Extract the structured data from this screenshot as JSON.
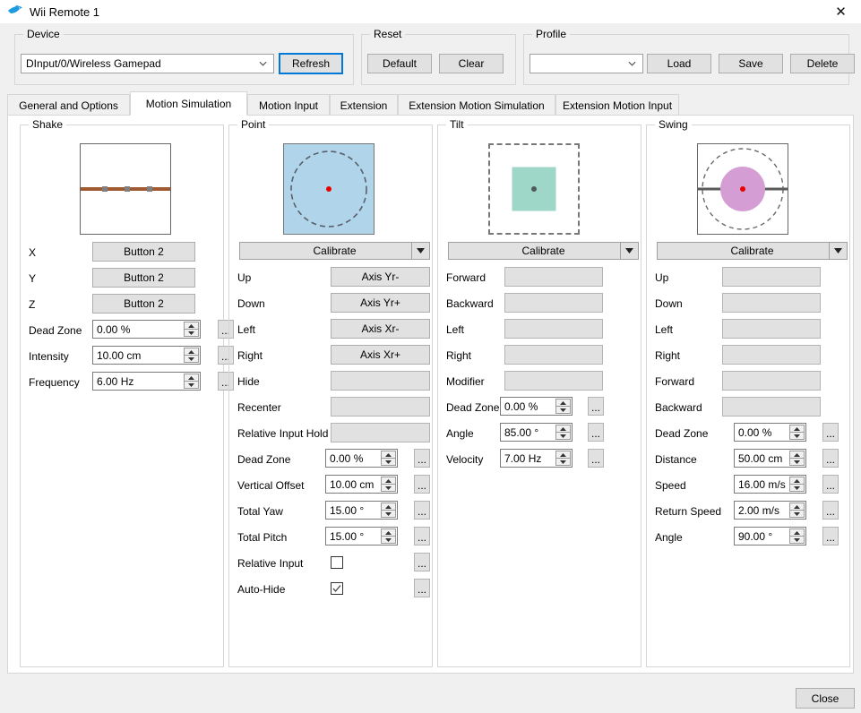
{
  "window": {
    "title": "Wii Remote 1",
    "icon": "dolphin-icon",
    "close_glyph": "✕"
  },
  "device": {
    "legend": "Device",
    "selected": "DInput/0/Wireless Gamepad",
    "refresh_label": "Refresh"
  },
  "reset": {
    "legend": "Reset",
    "default_label": "Default",
    "clear_label": "Clear"
  },
  "profile": {
    "legend": "Profile",
    "selected": "",
    "load_label": "Load",
    "save_label": "Save",
    "delete_label": "Delete"
  },
  "tabs": [
    {
      "label": "General and Options",
      "selected": false
    },
    {
      "label": "Motion Simulation",
      "selected": true
    },
    {
      "label": "Motion Input",
      "selected": false
    },
    {
      "label": "Extension",
      "selected": false
    },
    {
      "label": "Extension Motion Simulation",
      "selected": false
    },
    {
      "label": "Extension Motion Input",
      "selected": false
    }
  ],
  "shake": {
    "legend": "Shake",
    "rows": [
      {
        "label": "X",
        "value": "Button 2"
      },
      {
        "label": "Y",
        "value": "Button 2"
      },
      {
        "label": "Z",
        "value": "Button 2"
      }
    ],
    "spins": [
      {
        "label": "Dead Zone",
        "value": "0.00 %"
      },
      {
        "label": "Intensity",
        "value": "10.00 cm"
      },
      {
        "label": "Frequency",
        "value": "6.00 Hz"
      }
    ],
    "dots_label": "...",
    "preview": {
      "line_color": "#a05a32",
      "background": "#ffffff",
      "marker_color": "#808080"
    }
  },
  "point": {
    "legend": "Point",
    "calibrate_label": "Calibrate",
    "bindings": [
      {
        "label": "Up",
        "value": "Axis Yr-"
      },
      {
        "label": "Down",
        "value": "Axis Yr+"
      },
      {
        "label": "Left",
        "value": "Axis Xr-"
      },
      {
        "label": "Right",
        "value": "Axis Xr+"
      },
      {
        "label": "Hide",
        "value": ""
      },
      {
        "label": "Recenter",
        "value": ""
      },
      {
        "label": "Relative Input Hold",
        "value": ""
      }
    ],
    "spins": [
      {
        "label": "Dead Zone",
        "value": "0.00 %"
      },
      {
        "label": "Vertical Offset",
        "value": "10.00 cm"
      },
      {
        "label": "Total Yaw",
        "value": "15.00 °"
      },
      {
        "label": "Total Pitch",
        "value": "15.00 °"
      }
    ],
    "checks": [
      {
        "label": "Relative Input",
        "checked": false
      },
      {
        "label": "Auto-Hide",
        "checked": true
      }
    ],
    "dots_label": "...",
    "preview": {
      "fill": "#b0d4ea",
      "dot_color": "#e60000"
    }
  },
  "tilt": {
    "legend": "Tilt",
    "calibrate_label": "Calibrate",
    "bindings": [
      {
        "label": "Forward",
        "value": ""
      },
      {
        "label": "Backward",
        "value": ""
      },
      {
        "label": "Left",
        "value": ""
      },
      {
        "label": "Right",
        "value": ""
      },
      {
        "label": "Modifier",
        "value": ""
      }
    ],
    "spins": [
      {
        "label": "Dead Zone",
        "value": "0.00 %"
      },
      {
        "label": "Angle",
        "value": "85.00 °"
      },
      {
        "label": "Velocity",
        "value": "7.00 Hz"
      }
    ],
    "dots_label": "...",
    "preview": {
      "fill": "#9ed6c8",
      "dot_color": "#4f5a56"
    }
  },
  "swing": {
    "legend": "Swing",
    "calibrate_label": "Calibrate",
    "bindings": [
      {
        "label": "Up",
        "value": ""
      },
      {
        "label": "Down",
        "value": ""
      },
      {
        "label": "Left",
        "value": ""
      },
      {
        "label": "Right",
        "value": ""
      },
      {
        "label": "Forward",
        "value": ""
      },
      {
        "label": "Backward",
        "value": ""
      }
    ],
    "spins": [
      {
        "label": "Dead Zone",
        "value": "0.00 %"
      },
      {
        "label": "Distance",
        "value": "50.00 cm"
      },
      {
        "label": "Speed",
        "value": "16.00 m/s"
      },
      {
        "label": "Return Speed",
        "value": "2.00 m/s"
      },
      {
        "label": "Angle",
        "value": "90.00 °"
      }
    ],
    "dots_label": "...",
    "preview": {
      "fill": "#d49ed4",
      "dot_color": "#e60000",
      "line_color": "#5a5a5a"
    }
  },
  "footer": {
    "close_label": "Close"
  }
}
